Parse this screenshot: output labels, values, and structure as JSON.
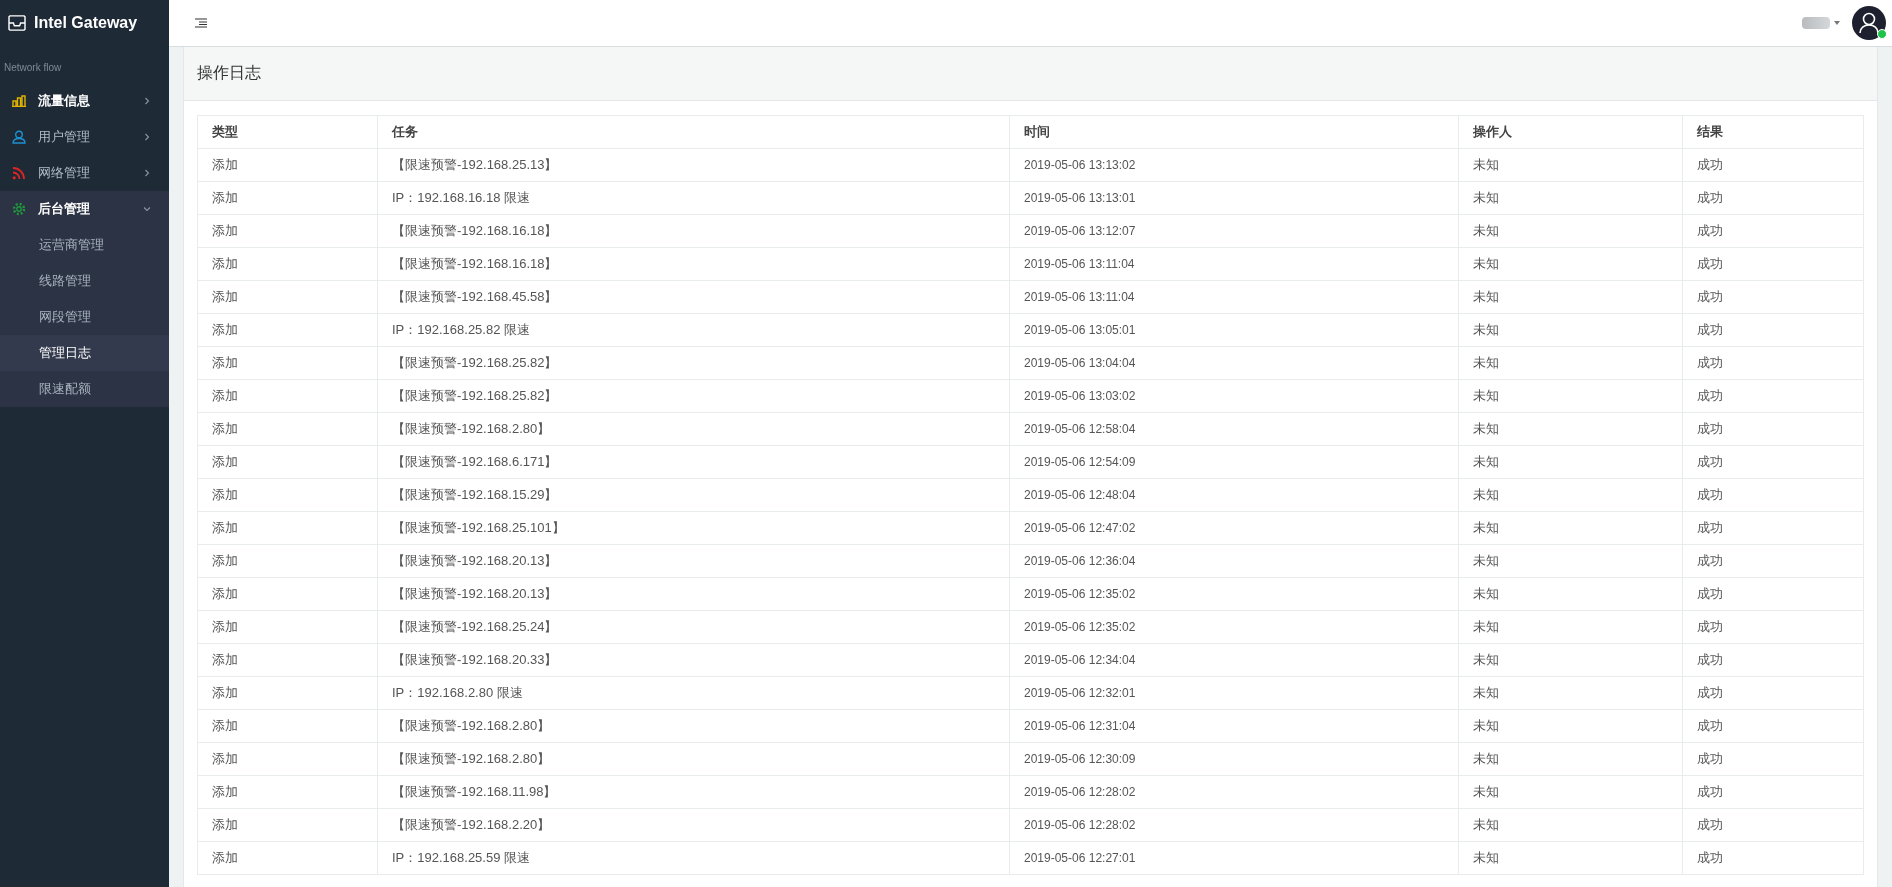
{
  "brand": {
    "title": "Intel Gateway"
  },
  "sidebar": {
    "section_label": "Network flow",
    "items": [
      {
        "label": "流量信息",
        "active": true,
        "expanded": false,
        "color": "#e0b400"
      },
      {
        "label": "用户管理",
        "active": false,
        "expanded": false,
        "color": "#1e90d0"
      },
      {
        "label": "网络管理",
        "active": false,
        "expanded": false,
        "color": "#e02424"
      },
      {
        "label": "后台管理",
        "active": true,
        "expanded": true,
        "color": "#1f9a3a",
        "children": [
          {
            "label": "运营商管理",
            "selected": false
          },
          {
            "label": "线路管理",
            "selected": false
          },
          {
            "label": "网段管理",
            "selected": false
          },
          {
            "label": "管理日志",
            "selected": true
          },
          {
            "label": "限速配额",
            "selected": false
          }
        ]
      }
    ]
  },
  "user": {
    "online": true
  },
  "page": {
    "title": "操作日志"
  },
  "table": {
    "columns": [
      "类型",
      "任务",
      "时间",
      "操作人",
      "结果"
    ],
    "rows": [
      [
        "添加",
        "【限速预警-192.168.25.13】",
        "2019-05-06 13:13:02",
        "未知",
        "成功"
      ],
      [
        "添加",
        "IP：192.168.16.18 限速",
        "2019-05-06 13:13:01",
        "未知",
        "成功"
      ],
      [
        "添加",
        "【限速预警-192.168.16.18】",
        "2019-05-06 13:12:07",
        "未知",
        "成功"
      ],
      [
        "添加",
        "【限速预警-192.168.16.18】",
        "2019-05-06 13:11:04",
        "未知",
        "成功"
      ],
      [
        "添加",
        "【限速预警-192.168.45.58】",
        "2019-05-06 13:11:04",
        "未知",
        "成功"
      ],
      [
        "添加",
        "IP：192.168.25.82 限速",
        "2019-05-06 13:05:01",
        "未知",
        "成功"
      ],
      [
        "添加",
        "【限速预警-192.168.25.82】",
        "2019-05-06 13:04:04",
        "未知",
        "成功"
      ],
      [
        "添加",
        "【限速预警-192.168.25.82】",
        "2019-05-06 13:03:02",
        "未知",
        "成功"
      ],
      [
        "添加",
        "【限速预警-192.168.2.80】",
        "2019-05-06 12:58:04",
        "未知",
        "成功"
      ],
      [
        "添加",
        "【限速预警-192.168.6.171】",
        "2019-05-06 12:54:09",
        "未知",
        "成功"
      ],
      [
        "添加",
        "【限速预警-192.168.15.29】",
        "2019-05-06 12:48:04",
        "未知",
        "成功"
      ],
      [
        "添加",
        "【限速预警-192.168.25.101】",
        "2019-05-06 12:47:02",
        "未知",
        "成功"
      ],
      [
        "添加",
        "【限速预警-192.168.20.13】",
        "2019-05-06 12:36:04",
        "未知",
        "成功"
      ],
      [
        "添加",
        "【限速预警-192.168.20.13】",
        "2019-05-06 12:35:02",
        "未知",
        "成功"
      ],
      [
        "添加",
        "【限速预警-192.168.25.24】",
        "2019-05-06 12:35:02",
        "未知",
        "成功"
      ],
      [
        "添加",
        "【限速预警-192.168.20.33】",
        "2019-05-06 12:34:04",
        "未知",
        "成功"
      ],
      [
        "添加",
        "IP：192.168.2.80 限速",
        "2019-05-06 12:32:01",
        "未知",
        "成功"
      ],
      [
        "添加",
        "【限速预警-192.168.2.80】",
        "2019-05-06 12:31:04",
        "未知",
        "成功"
      ],
      [
        "添加",
        "【限速预警-192.168.2.80】",
        "2019-05-06 12:30:09",
        "未知",
        "成功"
      ],
      [
        "添加",
        "【限速预警-192.168.11.98】",
        "2019-05-06 12:28:02",
        "未知",
        "成功"
      ],
      [
        "添加",
        "【限速预警-192.168.2.20】",
        "2019-05-06 12:28:02",
        "未知",
        "成功"
      ],
      [
        "添加",
        "IP：192.168.25.59 限速",
        "2019-05-06 12:27:01",
        "未知",
        "成功"
      ]
    ]
  }
}
